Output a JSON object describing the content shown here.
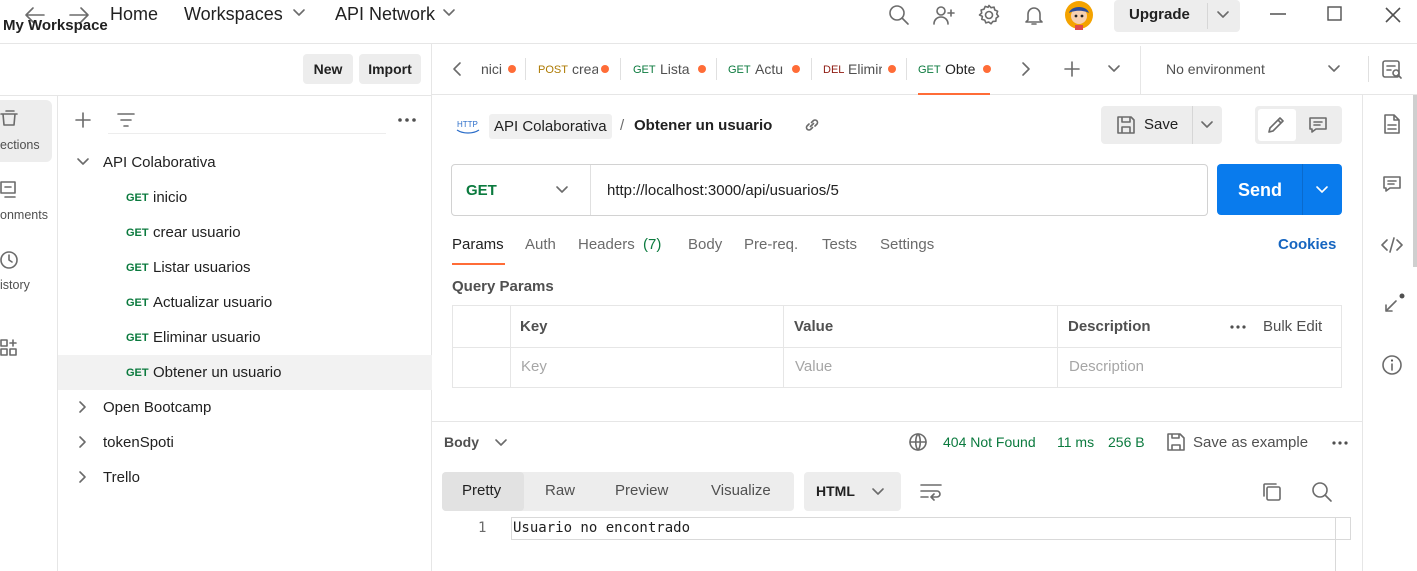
{
  "titlebar": {
    "home": "Home",
    "workspaces": "Workspaces",
    "api_network": "API Network",
    "upgrade": "Upgrade"
  },
  "workspace": {
    "title": "My Workspace",
    "new_label": "New",
    "import_label": "Import"
  },
  "left_rail": {
    "items": [
      {
        "label": "ections",
        "icon": "collections-icon"
      },
      {
        "label": "onments",
        "icon": "environments-icon"
      },
      {
        "label": "istory",
        "icon": "history-icon"
      },
      {
        "label": "",
        "icon": "apps-icon"
      }
    ]
  },
  "sidebar": {
    "collections": [
      {
        "name": "API Colaborativa",
        "expanded": true,
        "requests": [
          {
            "method": "GET",
            "name": "inicio"
          },
          {
            "method": "GET",
            "name": "crear usuario"
          },
          {
            "method": "GET",
            "name": "Listar usuarios"
          },
          {
            "method": "GET",
            "name": "Actualizar usuario"
          },
          {
            "method": "GET",
            "name": "Eliminar usuario"
          },
          {
            "method": "GET",
            "name": "Obtener un usuario",
            "selected": true
          }
        ]
      },
      {
        "name": "Open Bootcamp",
        "expanded": false
      },
      {
        "name": "tokenSpoti",
        "expanded": false
      },
      {
        "name": "Trello",
        "expanded": false
      }
    ]
  },
  "tabs": [
    {
      "method": "",
      "label": "nici"
    },
    {
      "method": "POST",
      "label": "crea"
    },
    {
      "method": "GET",
      "label": "Lista"
    },
    {
      "method": "GET",
      "label": "Actu"
    },
    {
      "method": "DEL",
      "label": "Elimir"
    },
    {
      "method": "GET",
      "label": "Obte",
      "active": true
    }
  ],
  "environment": {
    "selected": "No environment"
  },
  "request": {
    "collection": "API Colaborativa",
    "separator": "/",
    "name": "Obtener un usuario",
    "save_label": "Save",
    "method": "GET",
    "url": "http://localhost:3000/api/usuarios/5",
    "send_label": "Send",
    "tabs": {
      "params": "Params",
      "auth": "Auth",
      "headers": "Headers",
      "headers_count": "(7)",
      "body": "Body",
      "prereq": "Pre-req.",
      "tests": "Tests",
      "settings": "Settings"
    },
    "cookies_label": "Cookies",
    "query_params_title": "Query Params",
    "table": {
      "headers": [
        "Key",
        "Value",
        "Description"
      ],
      "bulk_edit": "Bulk Edit",
      "placeholders": [
        "Key",
        "Value",
        "Description"
      ]
    }
  },
  "response": {
    "body_label": "Body",
    "status": "404 Not Found",
    "time": "11 ms",
    "size": "256 B",
    "save_example": "Save as example",
    "views": [
      "Pretty",
      "Raw",
      "Preview",
      "Visualize"
    ],
    "active_view": "Pretty",
    "format": "HTML",
    "lines": [
      {
        "num": "1",
        "text": "Usuario no encontrado"
      }
    ]
  },
  "colors": {
    "accent": "#ff6c37",
    "send": "#097bed",
    "status_error": "#0b7a3e",
    "get_method": "#0b7a3e",
    "post_method": "#ad7a03",
    "del_method": "#8e1a10"
  }
}
